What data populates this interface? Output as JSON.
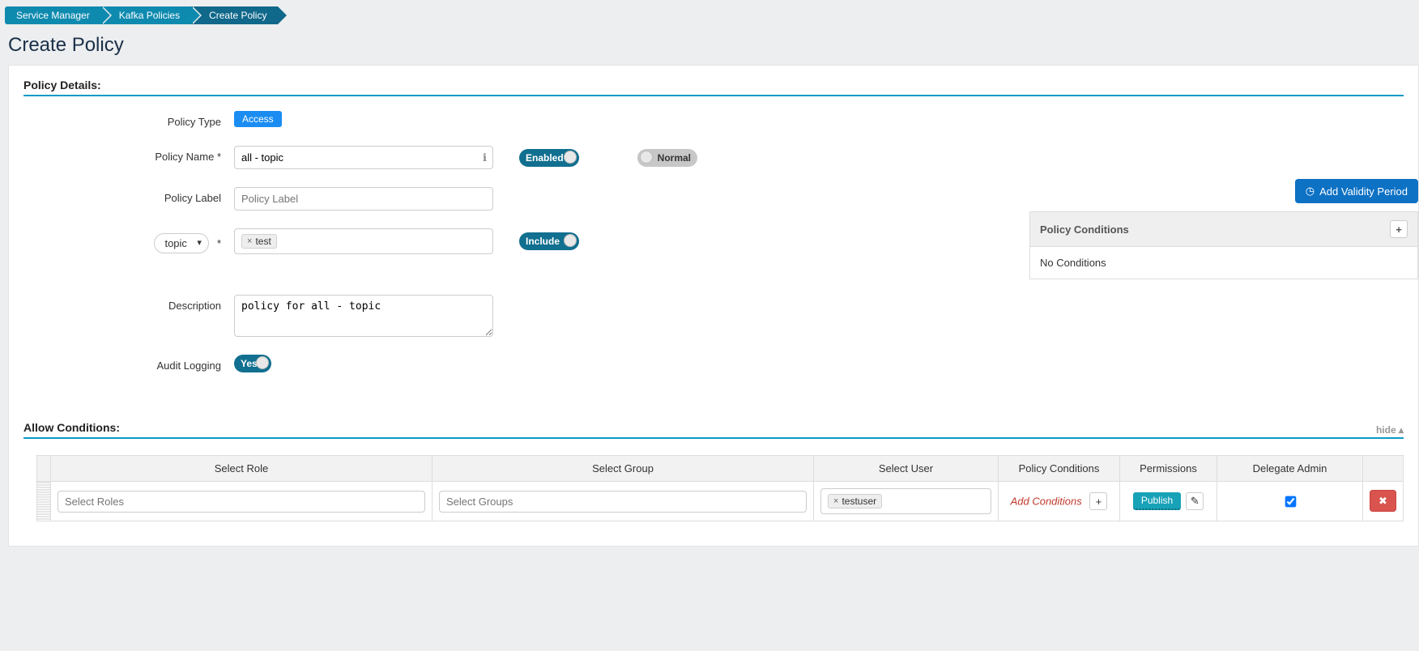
{
  "breadcrumbs": [
    "Service Manager",
    "Kafka Policies",
    "Create Policy"
  ],
  "page_heading": "Create Policy",
  "section_policy_details": "Policy Details:",
  "labels": {
    "policy_type": "Policy Type",
    "policy_name": "Policy Name *",
    "policy_label": "Policy Label",
    "resource": "topic",
    "description": "Description",
    "audit": "Audit Logging"
  },
  "policy_type_badge": "Access",
  "policy_name_value": "all - topic",
  "policy_label_placeholder": "Policy Label",
  "resource_required_mark": "*",
  "resource_tag": "test",
  "description_value": "policy for all - topic",
  "toggles": {
    "enabled": "Enabled",
    "normal": "Normal",
    "include": "Include",
    "audit_yes": "Yes"
  },
  "right": {
    "add_validity": "Add Validity Period",
    "conditions_title": "Policy Conditions",
    "no_conditions": "No Conditions"
  },
  "allow": {
    "title": "Allow Conditions:",
    "hide": "hide  ▴",
    "headers": {
      "role": "Select Role",
      "group": "Select Group",
      "user": "Select User",
      "cond": "Policy Conditions",
      "perm": "Permissions",
      "delegate": "Delegate Admin"
    },
    "row": {
      "roles_placeholder": "Select Roles",
      "groups_placeholder": "Select Groups",
      "user_tag": "testuser",
      "add_conditions": "Add Conditions",
      "publish": "Publish"
    }
  },
  "icons": {
    "info": "ℹ",
    "plus": "+",
    "clock": "◷",
    "pencil": "✎",
    "close": "✖",
    "x_small": "×"
  }
}
